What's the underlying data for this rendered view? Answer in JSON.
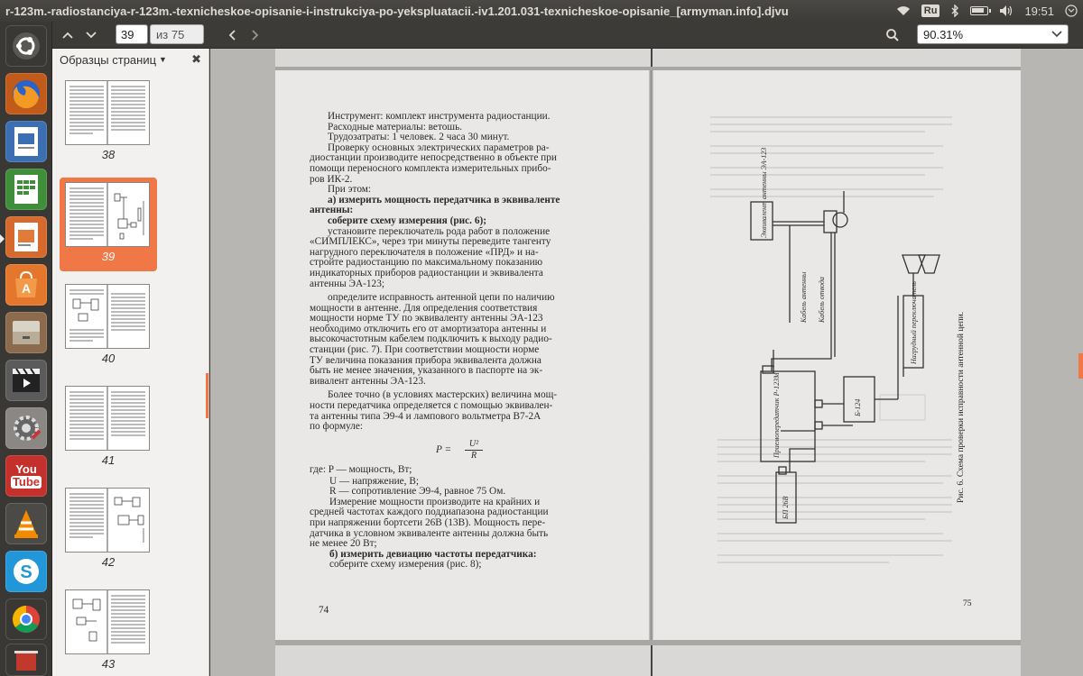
{
  "window": {
    "title": "r-123m.-radiostanciya-r-123m.-texnicheskoe-opisanie-i-instrukciya-po-yekspluatacii.-iv1.201.031-texnicheskoe-opisanie_[armyman.info].djvu"
  },
  "tray": {
    "keyboard_layout": "Ru",
    "time": "19:51",
    "icons": [
      "wifi-icon",
      "keyboard-layout-indicator",
      "bluetooth-icon",
      "battery-icon",
      "volume-icon",
      "power-icon"
    ]
  },
  "launcher": {
    "apps": [
      "ubuntu-dash",
      "firefox",
      "libreoffice-impress",
      "libreoffice-calc",
      "document-viewer",
      "software-center",
      "files",
      "video-editor",
      "system-settings",
      "youtube",
      "vlc",
      "skype",
      "chrome",
      "trash"
    ],
    "youtube_label_1": "You",
    "youtube_label_2": "Tube"
  },
  "toolbar": {
    "current_page": "39",
    "page_of": "из 75",
    "zoom": "90.31%"
  },
  "sidebar": {
    "title": "Образцы страниц",
    "thumbnails": [
      {
        "label": "38"
      },
      {
        "label": "39"
      },
      {
        "label": "40"
      },
      {
        "label": "41"
      },
      {
        "label": "42"
      },
      {
        "label": "43"
      }
    ]
  },
  "left_page": {
    "lines": [
      "Инструмент: комплект инструмента радиостанции.",
      "Расходные материалы: ветошь.",
      "Трудозатраты: 1 человек. 2 часа 30 минут.",
      "Проверку основных электрических параметров ра-",
      "диостанции производите непосредственно в объекте при",
      "помощи переносного комплекта измерительных прибо-",
      "ров ИК-2.",
      "При этом:",
      "а) измерить мощность передатчика в эквиваленте",
      "антенны:",
      "соберите схему измерения (рис. 6);",
      "установите переключатель рода работ в положение",
      "«СИМПЛЕКС», через три минуты переведите тангенту",
      "нагрудного переключателя в положение «ПРД» и на-",
      "стройте радиостанцию по максимальному показанию",
      "индикаторных приборов радиостанции и эквивалента",
      "антенны ЭА-123;",
      "определите исправность антенной цепи по наличию",
      "мощности в антенне. Для определения соответствия",
      "мощности норме ТУ по эквиваленту антенны ЭА-123",
      "необходимо отключить его от амортизатора антенны и",
      "высокочастотным кабелем подключить к выходу радио-",
      "станции (рис. 7). При соответствии мощности норме",
      "ТУ величина показания прибора эквивалента должна",
      "быть не менее значения, указанного в паспорте на эк-",
      "вивалент антенны ЭА-123.",
      "Более точно (в условиях мастерских) величина мощ-",
      "ности передатчика определяется с помощью эквивален-",
      "та антенны типа Э9-4 и лампового вольтметра В7-2А",
      "по формуле:"
    ],
    "formula_lhs": "P =",
    "formula_num": "U²",
    "formula_den": "R",
    "lines2": [
      "где: P — мощность, Вт;",
      "U — напряжение, В;",
      "R — сопротивление Э9-4, равное 75 Ом.",
      "Измерение мощности производите на крайних и",
      "средней частотах каждого поддиапазона радиостанции",
      "при напряжении бортсети 26В (13В). Мощность пере-",
      "датчика в условном эквиваленте антенны должна быть",
      "не менее 20 Вт;",
      "б) измерить девиацию частоты передатчика:",
      "соберите схему измерения (рис. 8);"
    ],
    "page_number": "74"
  },
  "right_page": {
    "caption": "Рис. 6. Схема проверки исправности антенной цепи.",
    "labels": {
      "equivalent": "Эквивалент антенны ЭА-123",
      "cable1": "Кабель антенны",
      "cable2": "Кабель отвода",
      "transceiver": "Приемопередатчик Р-123М",
      "unit": "Б-124",
      "headset": "Нагрудный переключатель",
      "power": "БП 26В"
    },
    "page_number": "75"
  }
}
